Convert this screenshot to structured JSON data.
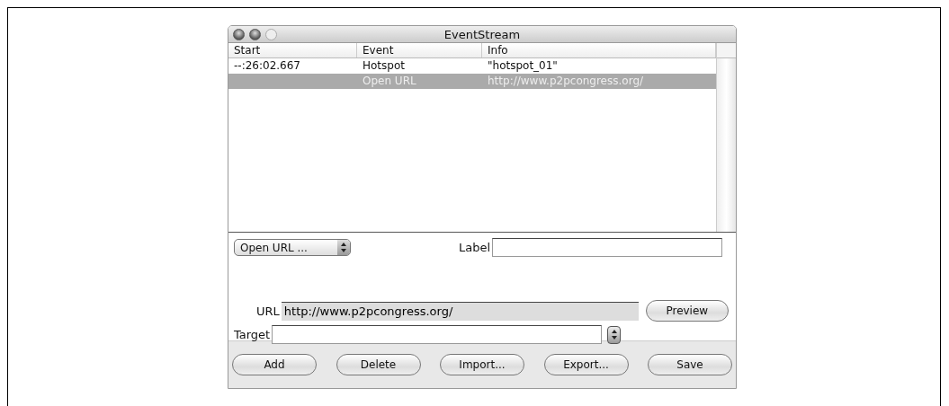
{
  "window": {
    "title": "EventStream"
  },
  "table": {
    "columns": [
      "Start",
      "Event",
      "Info"
    ],
    "rows": [
      {
        "start": "--:26:02.667",
        "event": "Hotspot",
        "info": "\"hotspot_01\"",
        "selected": false
      },
      {
        "event": "Open URL",
        "info": "http://www.p2pcongress.org/",
        "selected": true
      }
    ]
  },
  "event_type": {
    "value": "Open URL ..."
  },
  "label_field": {
    "label": "Label"
  },
  "url_field": {
    "label": "URL",
    "value": "http://www.p2pcongress.org/"
  },
  "target_field": {
    "label": "Target"
  },
  "preview_button": "Preview",
  "buttons": [
    "Add",
    "Delete",
    "Import...",
    "Export...",
    "Save"
  ]
}
